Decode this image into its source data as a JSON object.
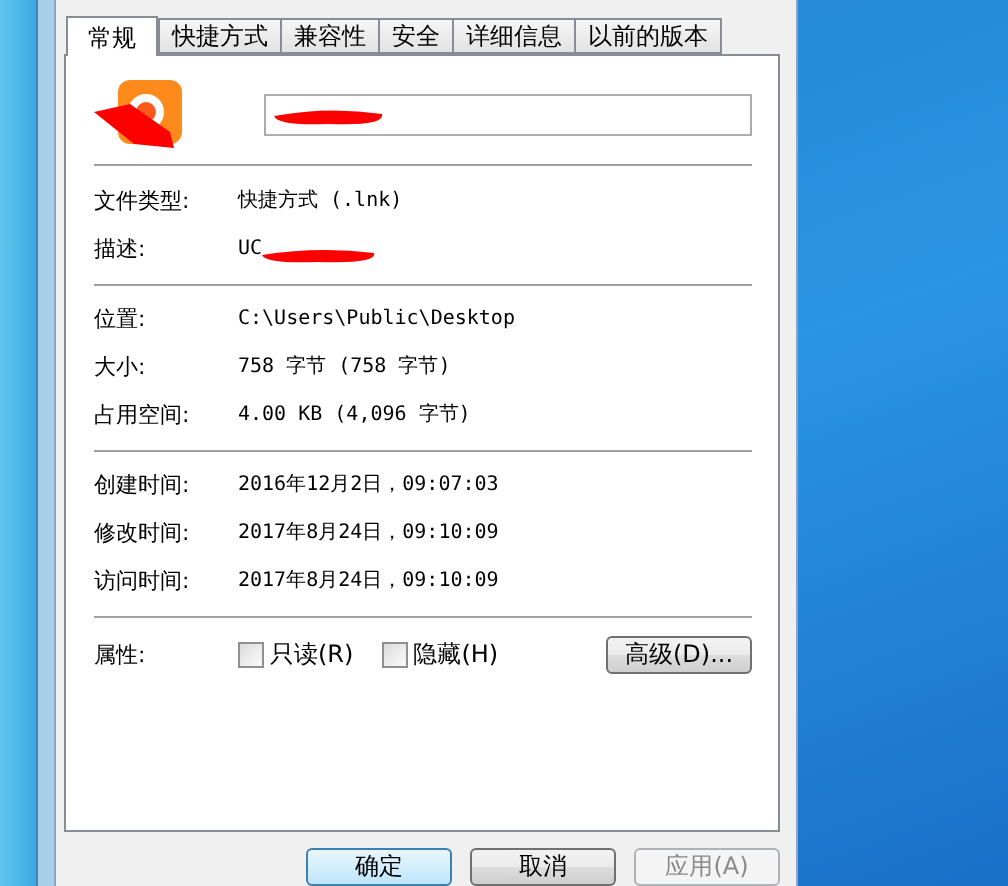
{
  "tabs": [
    {
      "label": "常规",
      "selected": true
    },
    {
      "label": "快捷方式",
      "selected": false
    },
    {
      "label": "兼容性",
      "selected": false
    },
    {
      "label": "安全",
      "selected": false
    },
    {
      "label": "详细信息",
      "selected": false
    },
    {
      "label": "以前的版本",
      "selected": false
    }
  ],
  "header": {
    "icon_redacted": true,
    "name_field": {
      "redacted": true
    }
  },
  "groups": [
    [
      {
        "label": "文件类型:",
        "value": "快捷方式 (.lnk)",
        "redacted": false
      },
      {
        "label": "描述:",
        "value": "UC",
        "redacted": true
      }
    ],
    [
      {
        "label": "位置:",
        "value": "C:\\Users\\Public\\Desktop",
        "redacted": false
      },
      {
        "label": "大小:",
        "value": "758 字节 (758 字节)",
        "redacted": false
      },
      {
        "label": "占用空间:",
        "value": "4.00 KB (4,096 字节)",
        "redacted": false
      }
    ],
    [
      {
        "label": "创建时间:",
        "value": "2016年12月2日，09:07:03",
        "redacted": false
      },
      {
        "label": "修改时间:",
        "value": "2017年8月24日，09:10:09",
        "redacted": false
      },
      {
        "label": "访问时间:",
        "value": "2017年8月24日，09:10:09",
        "redacted": false
      }
    ]
  ],
  "attributes": {
    "label": "属性:",
    "checkboxes": [
      {
        "label": "只读(R)",
        "checked": false
      },
      {
        "label": "隐藏(H)",
        "checked": false
      }
    ],
    "advanced_button": "高级(D)..."
  },
  "buttons": [
    {
      "label": "确定",
      "kind": "default",
      "disabled": false
    },
    {
      "label": "取消",
      "kind": "normal",
      "disabled": false
    },
    {
      "label": "应用(A)",
      "kind": "normal",
      "disabled": true
    }
  ]
}
